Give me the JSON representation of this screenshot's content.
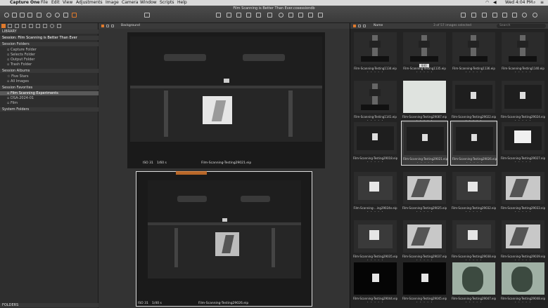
{
  "menubar": {
    "app": "Capture One",
    "items": [
      "File",
      "Edit",
      "View",
      "Adjustments",
      "Image",
      "Camera",
      "Window",
      "Scripts",
      "Help"
    ],
    "clock": "Wed 4:04 PM"
  },
  "toolbar": {
    "title": "Film Scanning is Better Than Ever.cosessiondb"
  },
  "sidebar": {
    "library_label": "LIBRARY",
    "session_name": "Session: Film Scanning is Better Than Ever",
    "session_folders_label": "Session Folders",
    "folders": [
      "Capture Folder",
      "Selects Folder",
      "Output Folder",
      "Trash Folder"
    ],
    "albums_label": "Session Albums",
    "albums": [
      "Five Stars",
      "All Images"
    ],
    "favorites_label": "Session Favorites",
    "favorites": [
      "Film Scanning Experiments",
      "DSA-2024-01",
      "Film"
    ],
    "system_folders_label": "System Folders",
    "bottom_label": "FOLDERS"
  },
  "viewer": {
    "background_label": "Background",
    "top_caption": "Film-Scanning-Testing29021.eip",
    "bottom_caption": "Film-Scanning-Testing29026.eip",
    "top_iso": "ISO 31",
    "top_shutter": "1/60 s",
    "bottom_iso": "ISO 31",
    "bottom_shutter": "1/40 s"
  },
  "browser": {
    "sort_label": "Name",
    "count_label": "3 of 57 images selected",
    "search_placeholder": "Search",
    "badge_label": "840",
    "thumbs": [
      {
        "name": "Film-Scanning-Testing1134.eip",
        "kind": "rig",
        "selected": false
      },
      {
        "name": "Film-Scanning-Testing1135.eip",
        "kind": "rig",
        "selected": false
      },
      {
        "name": "Film-Scanning-Testing1136.eip",
        "kind": "rig",
        "selected": false
      },
      {
        "name": "Film-Scanning-Testing1140.eip",
        "kind": "rig",
        "selected": false
      },
      {
        "name": "Film-Scanning-Testing1141.eip",
        "kind": "rig",
        "selected": false
      },
      {
        "name": "Film-Scanning-Testing29087.eip",
        "kind": "white",
        "selected": false
      },
      {
        "name": "Film-Scanning-Testing29022.eip",
        "kind": "holder",
        "selected": false
      },
      {
        "name": "Film-Scanning-Testing29024.eip",
        "kind": "holder",
        "selected": false
      },
      {
        "name": "Film-Scanning-Testing29018.eip",
        "kind": "holder",
        "selected": false
      },
      {
        "name": "Film-Scanning-Testing29021.eip",
        "kind": "holder",
        "selected": true
      },
      {
        "name": "Film-Scanning-Testing29026.eip",
        "kind": "holder",
        "selected": true
      },
      {
        "name": "Film-Scanning-Testing29027.eip",
        "kind": "holderwhite",
        "selected": false
      },
      {
        "name": "Film-Scanning-...ing29024e.eip",
        "kind": "negative",
        "selected": false
      },
      {
        "name": "Film-Scanning-Testing29025.eip",
        "kind": "light",
        "selected": false
      },
      {
        "name": "Film-Scanning-Testing29032.eip",
        "kind": "negative",
        "selected": false
      },
      {
        "name": "Film-Scanning-Testing29033.eip",
        "kind": "light",
        "selected": false
      },
      {
        "name": "Film-Scanning-Testing29035.eip",
        "kind": "negative",
        "selected": false
      },
      {
        "name": "Film-Scanning-Testing29037.eip",
        "kind": "light",
        "selected": false
      },
      {
        "name": "Film-Scanning-Testing29038.eip",
        "kind": "negative",
        "selected": false
      },
      {
        "name": "Film-Scanning-Testing29039.eip",
        "kind": "light",
        "selected": false
      },
      {
        "name": "Film-Scanning-Testing29044.eip",
        "kind": "dark",
        "selected": false
      },
      {
        "name": "Film-Scanning-Testing29045.eip",
        "kind": "dark",
        "selected": false
      },
      {
        "name": "Film-Scanning-Testing29047.eip",
        "kind": "tree",
        "selected": false
      },
      {
        "name": "Film-Scanning-Testing29048.eip",
        "kind": "tree",
        "selected": false
      }
    ]
  }
}
